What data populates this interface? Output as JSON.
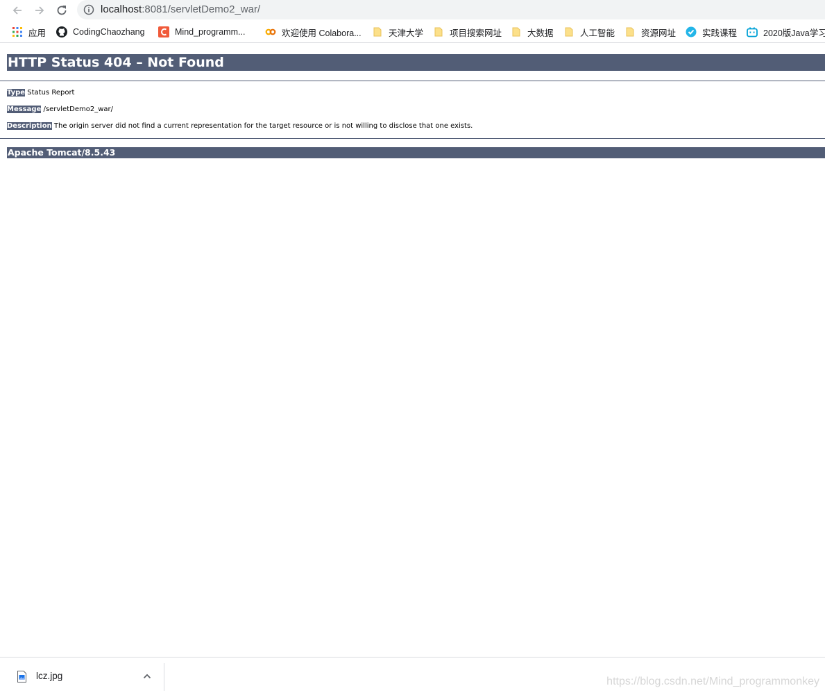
{
  "browser": {
    "url_host": "localhost",
    "url_path": ":8081/servletDemo2_war/",
    "bookmarks": [
      {
        "label": "应用",
        "icon": "apps-grid-icon"
      },
      {
        "label": "CodingChaozhang",
        "icon": "github-icon"
      },
      {
        "label": "Mind_programm...",
        "icon": "csdn-icon"
      },
      {
        "label": "欢迎使用 Colabora...",
        "icon": "colab-icon"
      },
      {
        "label": "天津大学",
        "icon": "folder-icon"
      },
      {
        "label": "项目搜索网址",
        "icon": "folder-icon"
      },
      {
        "label": "大数据",
        "icon": "folder-icon"
      },
      {
        "label": "人工智能",
        "icon": "folder-icon"
      },
      {
        "label": "资源网址",
        "icon": "folder-icon"
      },
      {
        "label": "实践课程",
        "icon": "course-icon"
      },
      {
        "label": "2020版Java学习",
        "icon": "bilibili-icon"
      }
    ]
  },
  "page": {
    "title": "HTTP Status 404 – Not Found",
    "type_label": "Type",
    "type_value": "Status Report",
    "message_label": "Message",
    "message_value": "/servletDemo2_war/",
    "description_label": "Description",
    "description_value": "The origin server did not find a current representation for the target resource or is not willing to disclose that one exists.",
    "server": "Apache Tomcat/8.5.43"
  },
  "downloads": {
    "file_name": "lcz.jpg"
  },
  "watermark": "https://blog.csdn.net/Mind_programmonkey",
  "colors": {
    "tomcat_bar": "#525d76",
    "omnibox_bg": "#f1f3f4"
  }
}
